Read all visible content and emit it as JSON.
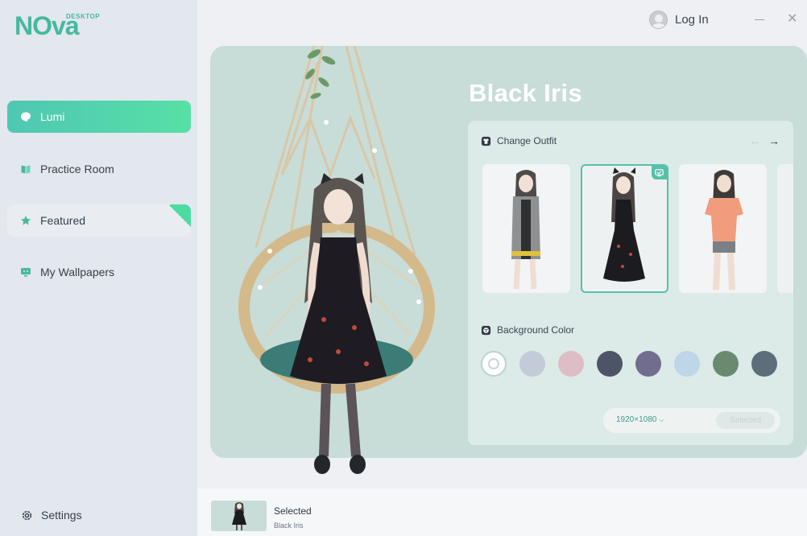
{
  "app": {
    "logo_text": "NOva",
    "logo_subtext": "DESKTOP"
  },
  "sidebar": {
    "items": [
      {
        "label": "Lumi",
        "icon": "heart-chat-icon",
        "active": true
      },
      {
        "label": "Practice Room",
        "icon": "book-icon",
        "active": false
      },
      {
        "label": "Featured",
        "icon": "star-icon",
        "active": false
      },
      {
        "label": "My Wallpapers",
        "icon": "monitor-icon",
        "active": false
      }
    ],
    "settings_label": "Settings"
  },
  "header": {
    "login_label": "Log In",
    "minimize_icon": "minimize-icon",
    "close_icon": "close-icon",
    "close_glyph": "✕"
  },
  "main": {
    "title": "Black Iris",
    "outfit_section": {
      "label": "Change Outfit",
      "prev_glyph": "←",
      "next_glyph": "→",
      "outfits": [
        {
          "name": "outfit-grey-cardigan",
          "selected": false
        },
        {
          "name": "outfit-black-dress",
          "selected": true
        },
        {
          "name": "outfit-peach-tee",
          "selected": false
        }
      ]
    },
    "background_section": {
      "label": "Background Color",
      "colors": [
        "#ffffff",
        "#c3cbd8",
        "#ddbdc6",
        "#4e5467",
        "#716d8f",
        "#bdd6e8",
        "#6a8a70",
        "#5d6d79"
      ],
      "selected_index": 0
    },
    "resolution": {
      "value": "1920×1080",
      "button_label": "Selected"
    }
  },
  "bottom_bar": {
    "title": "Selected",
    "subtitle": "Black Iris"
  },
  "colors": {
    "accent": "#4fc7b3",
    "accent_end": "#57e0a6",
    "stage_bg": "#c8dcd8",
    "sidebar_bg": "#e3e7ee"
  }
}
